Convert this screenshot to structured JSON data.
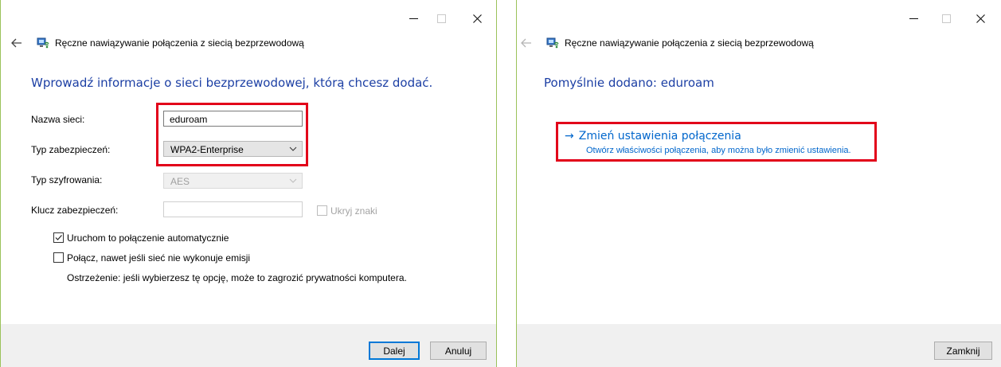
{
  "window1": {
    "caption": {
      "minimize": "—",
      "close": "✕"
    },
    "title": "Ręczne nawiązywanie połączenia z siecią bezprzewodową",
    "heading": "Wprowadź informacje o sieci bezprzewodowej, którą chcesz dodać.",
    "fields": {
      "network_name_label": "Nazwa sieci:",
      "network_name_value": "eduroam",
      "security_type_label": "Typ zabezpieczeń:",
      "security_type_value": "WPA2-Enterprise",
      "encryption_type_label": "Typ szyfrowania:",
      "encryption_type_value": "AES",
      "security_key_label": "Klucz zabezpieczeń:",
      "security_key_value": "",
      "hide_chars_label": "Ukryj znaki"
    },
    "checkboxes": {
      "auto_start_label": "Uruchom to połączenie automatycznie",
      "auto_start_checked": true,
      "connect_hidden_label": "Połącz, nawet jeśli sieć nie wykonuje emisji",
      "connect_hidden_checked": false,
      "warning": "Ostrzeżenie: jeśli wybierzesz tę opcję, może to zagrozić prywatności komputera."
    },
    "buttons": {
      "next": "Dalej",
      "cancel": "Anuluj"
    }
  },
  "window2": {
    "caption": {
      "minimize": "—",
      "close": "✕"
    },
    "title": "Ręczne nawiązywanie połączenia z siecią bezprzewodową",
    "heading": "Pomyślnie dodano: eduroam",
    "link": {
      "arrow": "→",
      "title": "Zmień ustawienia połączenia",
      "subtitle": "Otwórz właściwości połączenia, aby można było zmienić ustawienia."
    },
    "buttons": {
      "close": "Zamknij"
    }
  },
  "colors": {
    "highlight": "#e2001a",
    "heading": "#1c3fa4",
    "link": "#0066cc",
    "window_border": "#9bc25a"
  }
}
